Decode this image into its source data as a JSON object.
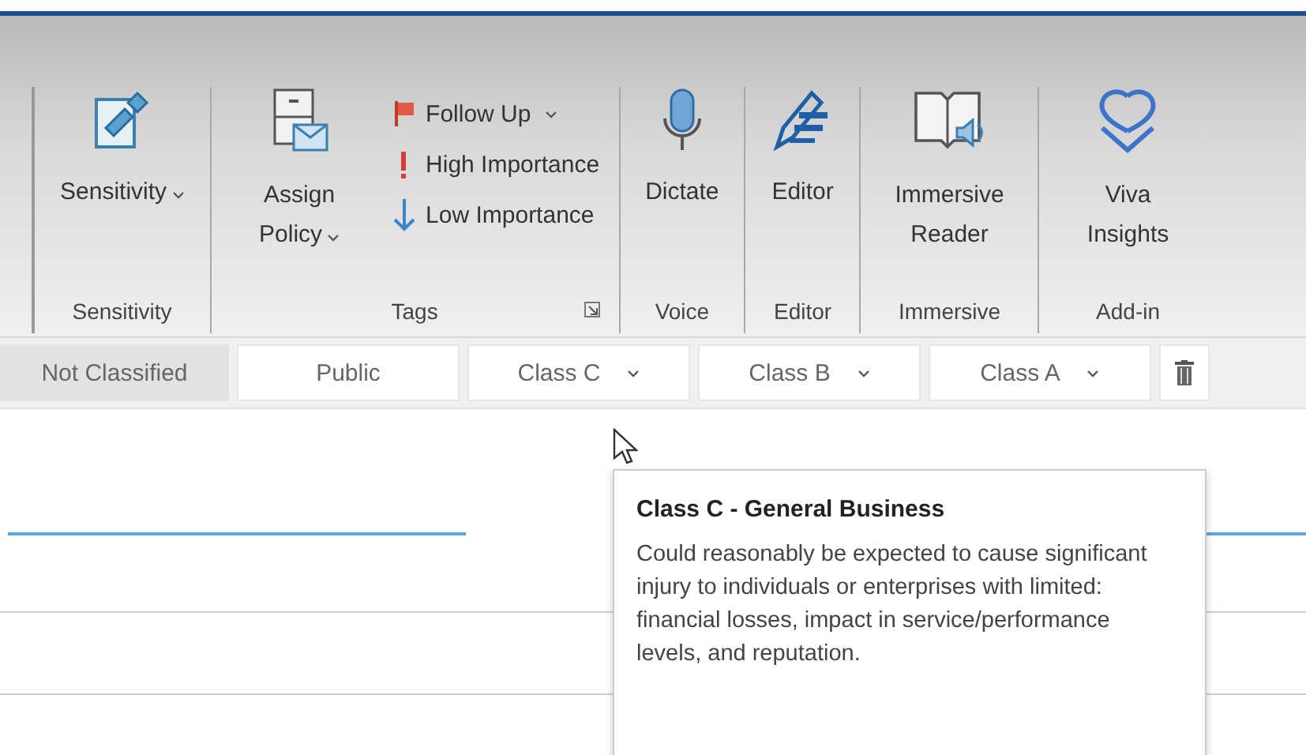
{
  "ribbon": {
    "groups": [
      {
        "label": "Sensitivity",
        "items": [
          {
            "kind": "large",
            "label": "Sensitivity",
            "dropdown": true
          }
        ]
      },
      {
        "label": "Tags",
        "launcher": true,
        "items": [
          {
            "kind": "large",
            "label": "Assign Policy",
            "dropdown": true
          },
          {
            "kind": "small",
            "label": "Follow Up",
            "dropdown": true
          },
          {
            "kind": "small",
            "label": "High Importance",
            "dropdown": false
          },
          {
            "kind": "small",
            "label": "Low Importance",
            "dropdown": false
          }
        ]
      },
      {
        "label": "Voice",
        "items": [
          {
            "kind": "large",
            "label": "Dictate",
            "dropdown": false
          }
        ]
      },
      {
        "label": "Editor",
        "items": [
          {
            "kind": "large",
            "label": "Editor",
            "dropdown": false
          }
        ]
      },
      {
        "label": "Immersive",
        "items": [
          {
            "kind": "large",
            "label": "Immersive Reader",
            "dropdown": false
          }
        ]
      },
      {
        "label": "Add-in",
        "items": [
          {
            "kind": "large",
            "label": "Viva Insights",
            "dropdown": false
          }
        ]
      }
    ]
  },
  "classification_bar": {
    "options": [
      {
        "label": "Not Classified",
        "selected": true,
        "dropdown": false
      },
      {
        "label": "Public",
        "selected": false,
        "dropdown": false
      },
      {
        "label": "Class C",
        "selected": false,
        "dropdown": true
      },
      {
        "label": "Class B",
        "selected": false,
        "dropdown": true
      },
      {
        "label": "Class A",
        "selected": false,
        "dropdown": true
      }
    ]
  },
  "tooltip": {
    "title": "Class C - General Business",
    "text": "Could reasonably be expected to cause significant injury to individuals or enterprises with limited: financial losses, impact in service/performance levels, and reputation."
  }
}
